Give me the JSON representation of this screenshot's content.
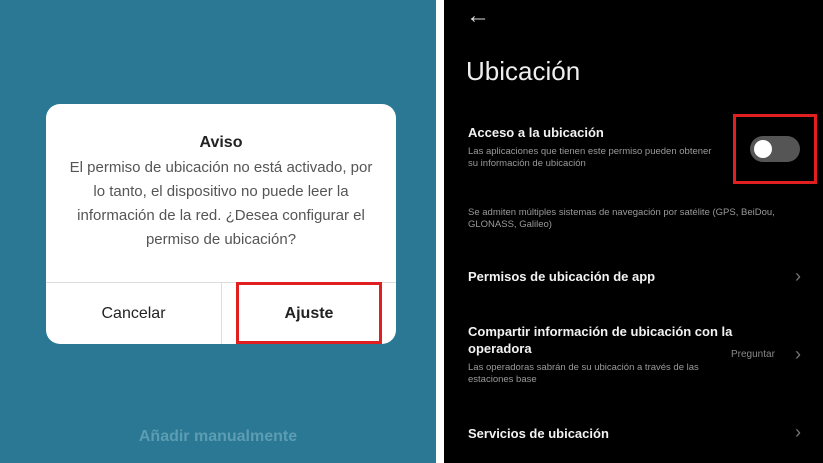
{
  "left": {
    "dialog": {
      "title": "Aviso",
      "message": "El permiso de ubicación no está activado, por lo tanto, el dispositivo no puede leer la información de la red. ¿Desea configurar el permiso de ubicación?",
      "cancel_label": "Cancelar",
      "confirm_label": "Ajuste"
    },
    "footer_label": "Añadir manualmente",
    "background_color": "#2a7893",
    "highlight_color": "#e02020"
  },
  "right": {
    "back_icon": "arrow-left-icon",
    "title": "Ubicación",
    "location_access": {
      "title": "Acceso a la ubicación",
      "subtitle": "Las aplicaciones que tienen este permiso pueden obtener su información de ubicación",
      "enabled": false
    },
    "gnss_note": "Se admiten múltiples sistemas de navegación por satélite (GPS, BeiDou, GLONASS, Galileo)",
    "items": [
      {
        "title": "Permisos de ubicación de app"
      },
      {
        "title": "Compartir información de ubicación con la operadora",
        "subtitle": "Las operadoras sabrán de su ubicación a través de las estaciones base",
        "value": "Preguntar"
      },
      {
        "title": "Servicios de ubicación"
      }
    ]
  }
}
